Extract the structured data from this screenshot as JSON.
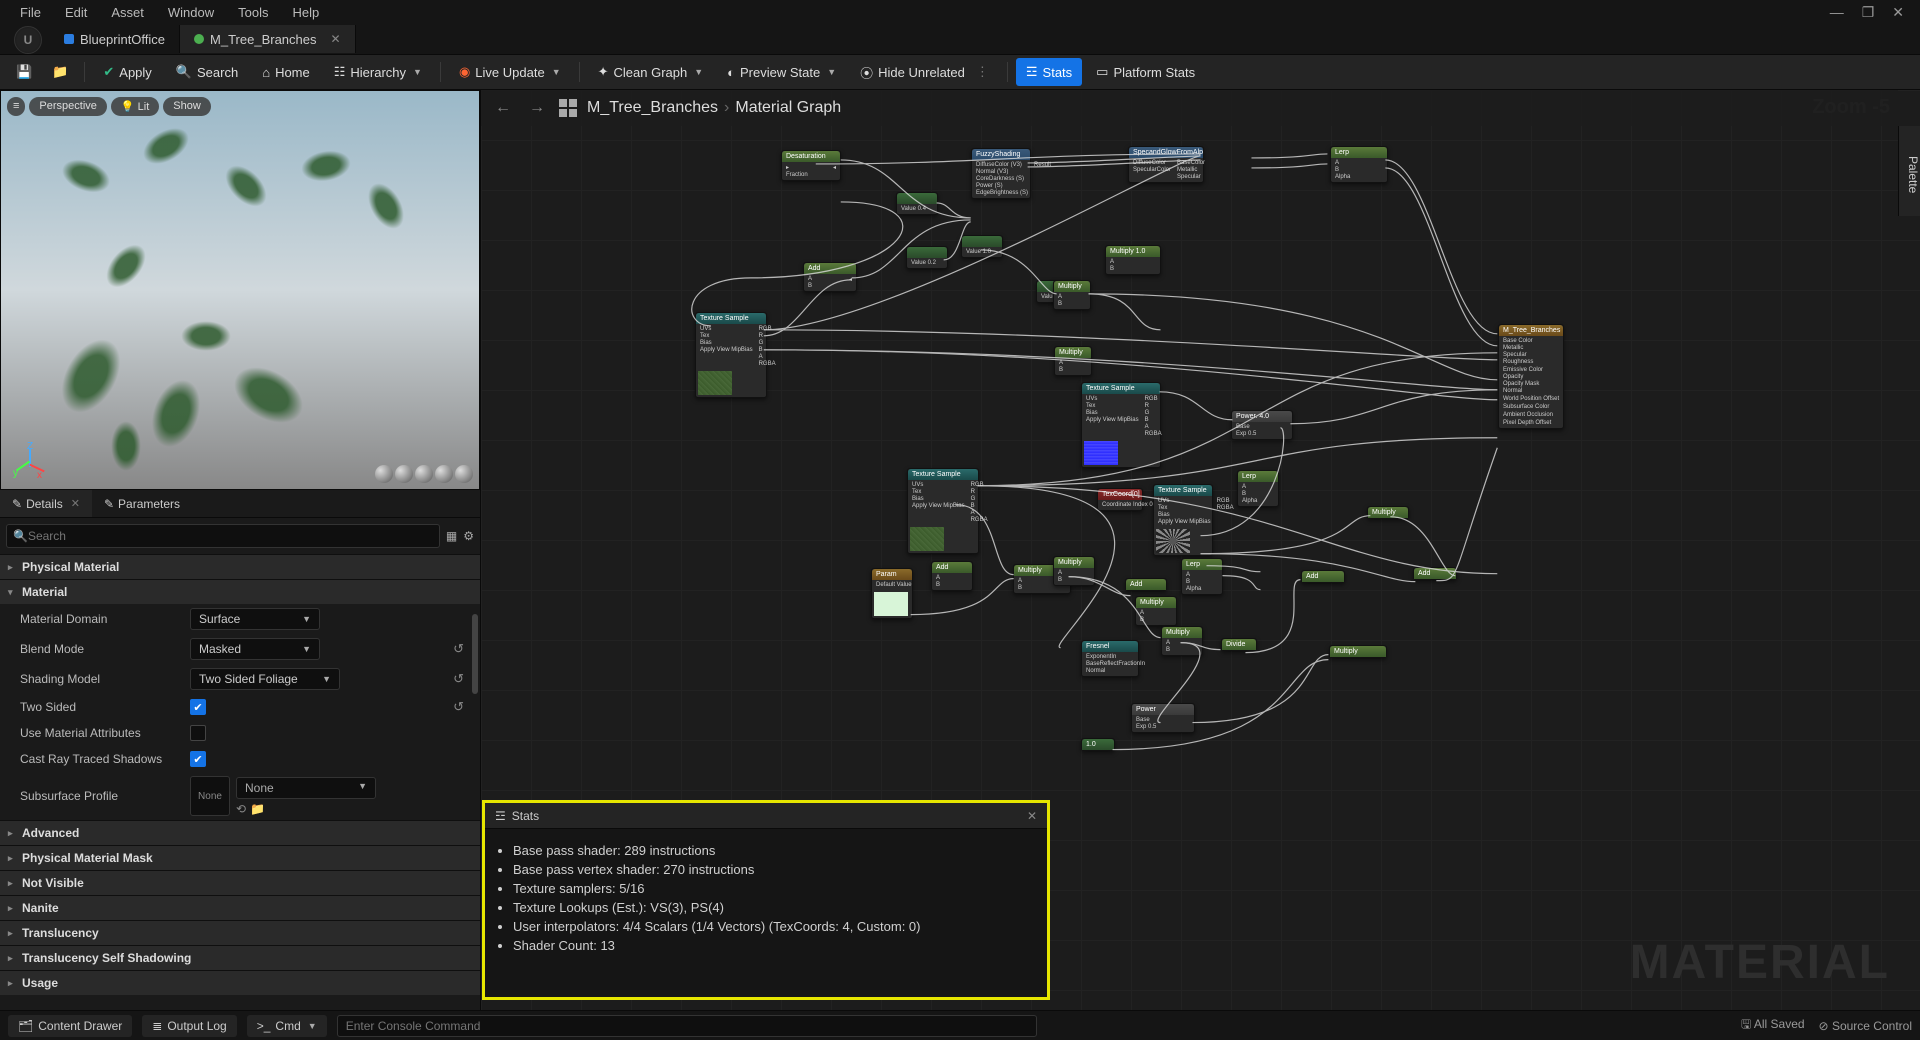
{
  "menus": [
    "File",
    "Edit",
    "Asset",
    "Window",
    "Tools",
    "Help"
  ],
  "tabs": [
    {
      "label": "BlueprintOffice",
      "active": false,
      "color": "blue"
    },
    {
      "label": "M_Tree_Branches",
      "active": true,
      "color": "green"
    }
  ],
  "toolbar": {
    "save": "",
    "browse": "",
    "apply": "Apply",
    "search": "Search",
    "home": "Home",
    "hierarchy": "Hierarchy",
    "liveupdate": "Live Update",
    "cleangraph": "Clean Graph",
    "previewstate": "Preview State",
    "hideunrelated": "Hide Unrelated",
    "stats": "Stats",
    "platformstats": "Platform Stats"
  },
  "viewport": {
    "mode": "Perspective",
    "lighting": "Lit",
    "show": "Show"
  },
  "panels": {
    "details": "Details",
    "parameters": "Parameters"
  },
  "search": {
    "placeholder": "Search"
  },
  "categories": {
    "physmat": "Physical Material",
    "material": "Material",
    "advanced": "Advanced",
    "physmask": "Physical Material Mask",
    "notvisible": "Not Visible",
    "nanite": "Nanite",
    "translucency": "Translucency",
    "transshadow": "Translucency Self Shadowing",
    "usage": "Usage"
  },
  "props": {
    "matdomain": {
      "label": "Material Domain",
      "value": "Surface"
    },
    "blendmode": {
      "label": "Blend Mode",
      "value": "Masked"
    },
    "shadingmodel": {
      "label": "Shading Model",
      "value": "Two Sided Foliage"
    },
    "twosided": {
      "label": "Two Sided",
      "checked": true
    },
    "usematattr": {
      "label": "Use Material Attributes",
      "checked": false
    },
    "castrts": {
      "label": "Cast Ray Traced Shadows",
      "checked": true
    },
    "subsurface": {
      "label": "Subsurface Profile",
      "value": "None",
      "thumb": "None"
    }
  },
  "graph": {
    "breadcrumb": [
      "M_Tree_Branches",
      "Material Graph"
    ],
    "zoom": "Zoom -5",
    "watermark": "MATERIAL",
    "palette": "Palette"
  },
  "nodes": {
    "fuzzy": {
      "title": "FuzzyShading",
      "pins_l": [
        "DiffuseColor (V3)",
        "Normal (V3)",
        "CoreDarkness (S)",
        "Power (S)",
        "EdgeBrightness (S)"
      ],
      "pins_r": [
        "Result"
      ]
    },
    "specglow": {
      "title": "SpecandGlowFromAlpha",
      "pins_l": [
        "DiffuseColor",
        "SpecularColor"
      ],
      "pins_r": [
        "BaseColor",
        "Metallic",
        "Specular"
      ]
    },
    "outnode": {
      "title": "M_Tree_Branches",
      "pins": [
        "Base Color",
        "Metallic",
        "Specular",
        "Roughness",
        "",
        "Emissive Color",
        "Opacity",
        "Opacity Mask",
        "Normal",
        "",
        "World Position Offset",
        "",
        "Subsurface Color",
        "",
        "Ambient Occlusion",
        "",
        "Pixel Depth Offset"
      ]
    },
    "texsample": "Texture Sample",
    "texsample_l": [
      "UVs",
      "Tex",
      "Bias",
      "Apply View MipBias"
    ],
    "texsample_r": [
      "RGB",
      "R",
      "G",
      "B",
      "A",
      "RGBA"
    ],
    "texcoord": "TexCoord[0]",
    "fresnel": "Fresnel",
    "coordidx": "Coordinate Index  0",
    "multiply": "Multiply",
    "add": "Add",
    "lerp": "Lerp",
    "power": "Power",
    "divide": "Divide",
    "defval": "Default Value",
    "exponent": "ExponentIn",
    "basereflect": "BaseReflectFractionIn",
    "normal": "Normal",
    "base": "Base",
    "exp": "Exp  0.5",
    "fraction": "Fraction",
    "valA": "Value  0.4",
    "valB": "Value  0.2",
    "valC": "Value  1.0",
    "valD": "Value  0.0",
    "sA": "A",
    "sB": "B",
    "sAlpha": "Alpha"
  },
  "stats": {
    "title": "Stats",
    "lines": [
      "Base pass shader: 289 instructions",
      "Base pass vertex shader: 270 instructions",
      "Texture samplers: 5/16",
      "Texture Lookups (Est.): VS(3), PS(4)",
      "User interpolators: 4/4 Scalars (1/4 Vectors) (TexCoords: 4, Custom: 0)",
      "Shader Count: 13"
    ]
  },
  "statusbar": {
    "drawer": "Content Drawer",
    "outputlog": "Output Log",
    "cmd": "Cmd",
    "cmdplaceholder": "Enter Console Command",
    "allsaved": "All Saved",
    "sourcecontrol": "Source Control"
  }
}
